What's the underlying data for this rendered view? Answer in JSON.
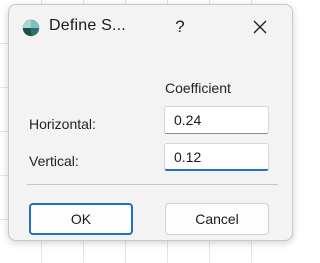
{
  "dialog": {
    "title": "Define S...",
    "help_label": "?",
    "icons": {
      "app": "globe-icon",
      "close": "close-icon"
    }
  },
  "table": {
    "column_header": "Coefficient",
    "rows": [
      {
        "label": "Horizontal:",
        "value": "0.24"
      },
      {
        "label": "Vertical:",
        "value": "0.12"
      }
    ]
  },
  "buttons": {
    "ok_label": "OK",
    "cancel_label": "Cancel"
  },
  "colors": {
    "accent": "#1f6fc5",
    "dialog_bg": "#f3f3f3"
  }
}
